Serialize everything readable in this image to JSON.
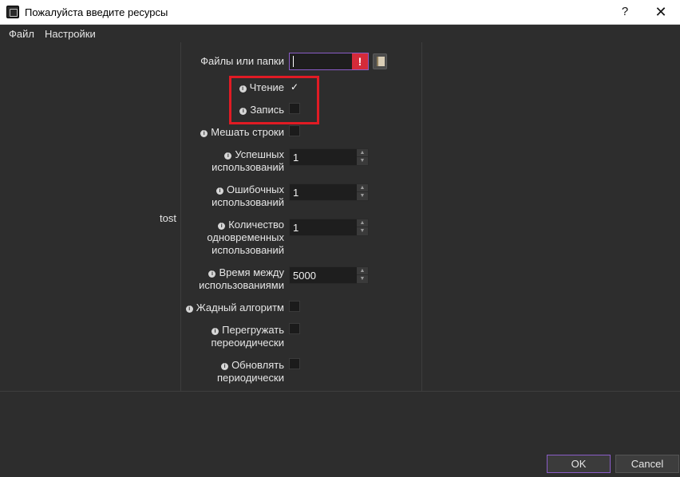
{
  "window": {
    "title": "Пожалуйста введите ресурсы",
    "help_label": "?",
    "close_label": "✕",
    "app_icon": "app-window-icon"
  },
  "menu": {
    "items": [
      {
        "label": "Файл"
      },
      {
        "label": "Настройки"
      }
    ]
  },
  "left_panel": {
    "resource_name": "tost"
  },
  "form": {
    "files": {
      "label": "Файлы или папки",
      "value": "",
      "error_glyph": "!",
      "error_color": "#d42b3a",
      "browse_icon": "folder-open-icon"
    },
    "read": {
      "label": "Чтение",
      "checked": true,
      "check_glyph": "✓"
    },
    "write": {
      "label": "Запись",
      "checked": false
    },
    "shuffle": {
      "label": "Мешать строки",
      "checked": false
    },
    "success_uses": {
      "label_line1": "Успешных",
      "label_line2": "использований",
      "value": "1"
    },
    "error_uses": {
      "label_line1": "Ошибочных",
      "label_line2": "использований",
      "value": "1"
    },
    "concurrent_uses": {
      "label_line1": "Количество",
      "label_line2": "одновременных",
      "label_line3": "использований",
      "value": "1"
    },
    "interval": {
      "label_line1": "Время между",
      "label_line2": "использованиями",
      "value": "5000"
    },
    "greedy": {
      "label": "Жадный алгоритм",
      "checked": false
    },
    "reload": {
      "label_line1": "Перегружать",
      "label_line2": "переоидически",
      "checked": false
    },
    "update": {
      "label_line1": "Обновлять",
      "label_line2": "периодически",
      "checked": false
    },
    "info_glyph": "i"
  },
  "highlight": {
    "color": "#e01b24"
  },
  "buttons": {
    "ok_label": "OK",
    "cancel_label": "Cancel"
  },
  "spin": {
    "up_glyph": "▲",
    "down_glyph": "▼"
  }
}
